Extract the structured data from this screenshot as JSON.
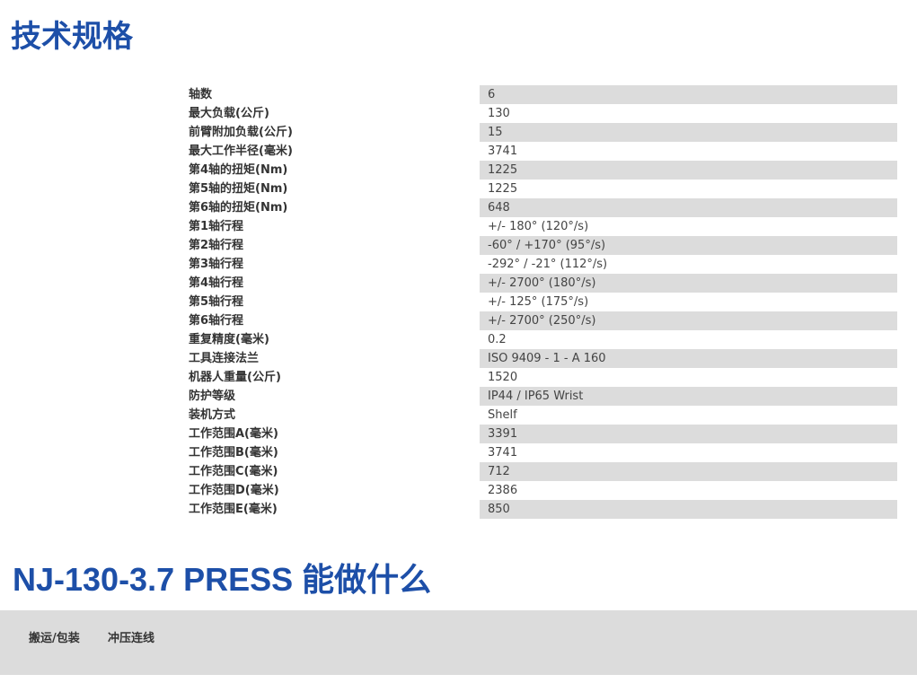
{
  "section_title": "技术规格",
  "specs": [
    {
      "label": "轴数",
      "value": "6"
    },
    {
      "label": "最大负载(公斤)",
      "value": "130"
    },
    {
      "label": "前臂附加负载(公斤)",
      "value": "15"
    },
    {
      "label": "最大工作半径(毫米)",
      "value": "3741"
    },
    {
      "label": "第4轴的扭矩(Nm)",
      "value": "1225"
    },
    {
      "label": "第5轴的扭矩(Nm)",
      "value": "1225"
    },
    {
      "label": "第6轴的扭矩(Nm)",
      "value": "648"
    },
    {
      "label": "第1轴行程",
      "value": "+/- 180° (120°/s)"
    },
    {
      "label": "第2轴行程",
      "value": "-60° / +170° (95°/s)"
    },
    {
      "label": "第3轴行程",
      "value": "-292° / -21° (112°/s)"
    },
    {
      "label": "第4轴行程",
      "value": "+/- 2700° (180°/s)"
    },
    {
      "label": "第5轴行程",
      "value": "+/- 125° (175°/s)"
    },
    {
      "label": "第6轴行程",
      "value": "+/- 2700° (250°/s)"
    },
    {
      "label": "重复精度(毫米)",
      "value": "0.2"
    },
    {
      "label": "工具连接法兰",
      "value": "ISO 9409 - 1 - A 160"
    },
    {
      "label": "机器人重量(公斤)",
      "value": "1520"
    },
    {
      "label": "防护等级",
      "value": "IP44 / IP65 Wrist"
    },
    {
      "label": "装机方式",
      "value": "Shelf"
    },
    {
      "label": "工作范围A(毫米)",
      "value": "3391"
    },
    {
      "label": "工作范围B(毫米)",
      "value": "3741"
    },
    {
      "label": "工作范围C(毫米)",
      "value": "712"
    },
    {
      "label": "工作范围D(毫米)",
      "value": "2386"
    },
    {
      "label": "工作范围E(毫米)",
      "value": "850"
    }
  ],
  "applications_title": "NJ-130-3.7 PRESS 能做什么",
  "tabs": [
    {
      "label": "搬运/包装"
    },
    {
      "label": "冲压连线"
    }
  ],
  "colors": {
    "heading": "#1d4fa8",
    "row_stripe": "#dcdcdc",
    "tabbar_bg": "#dcdcdc"
  }
}
